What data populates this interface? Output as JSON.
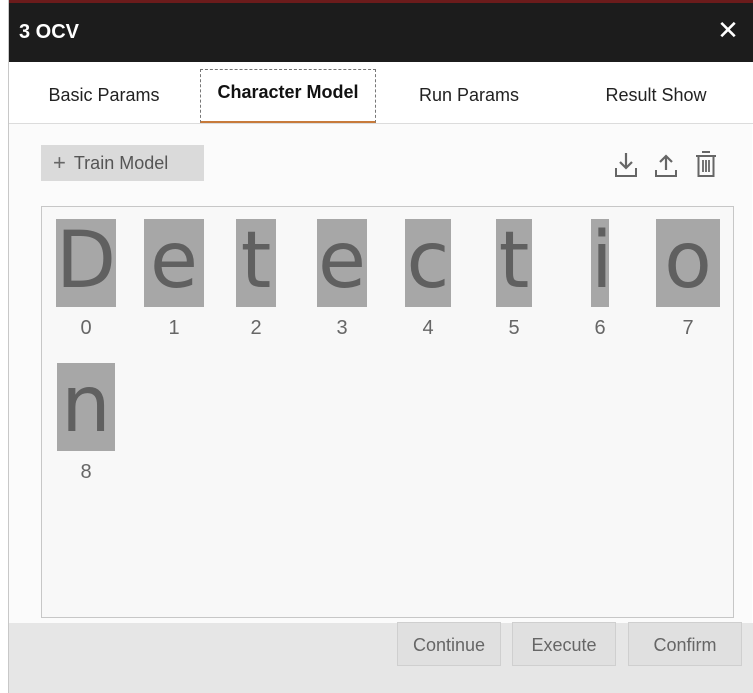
{
  "window": {
    "title": "3 OCV",
    "close_symbol": "✕"
  },
  "tabs": [
    {
      "label": "Basic Params",
      "active": false
    },
    {
      "label": "Character Model",
      "active": true
    },
    {
      "label": "Run Params",
      "active": false
    },
    {
      "label": "Result Show",
      "active": false
    }
  ],
  "toolbar": {
    "train_model_label": "Train Model",
    "icons": [
      "download-icon",
      "upload-icon",
      "trash-icon"
    ]
  },
  "characters": [
    {
      "glyph": "D",
      "index": "0"
    },
    {
      "glyph": "e",
      "index": "1"
    },
    {
      "glyph": "t",
      "index": "2"
    },
    {
      "glyph": "e",
      "index": "3"
    },
    {
      "glyph": "c",
      "index": "4"
    },
    {
      "glyph": "t",
      "index": "5"
    },
    {
      "glyph": "i",
      "index": "6"
    },
    {
      "glyph": "o",
      "index": "7"
    },
    {
      "glyph": "n",
      "index": "8"
    }
  ],
  "footer": {
    "continue_label": "Continue",
    "execute_label": "Execute",
    "confirm_label": "Confirm"
  },
  "colors": {
    "titlebar_bg": "#1c1c1c",
    "active_tab_underline": "#c77a3a",
    "glyph_bg": "#a7a7a7",
    "glyph_fg": "#606060"
  }
}
